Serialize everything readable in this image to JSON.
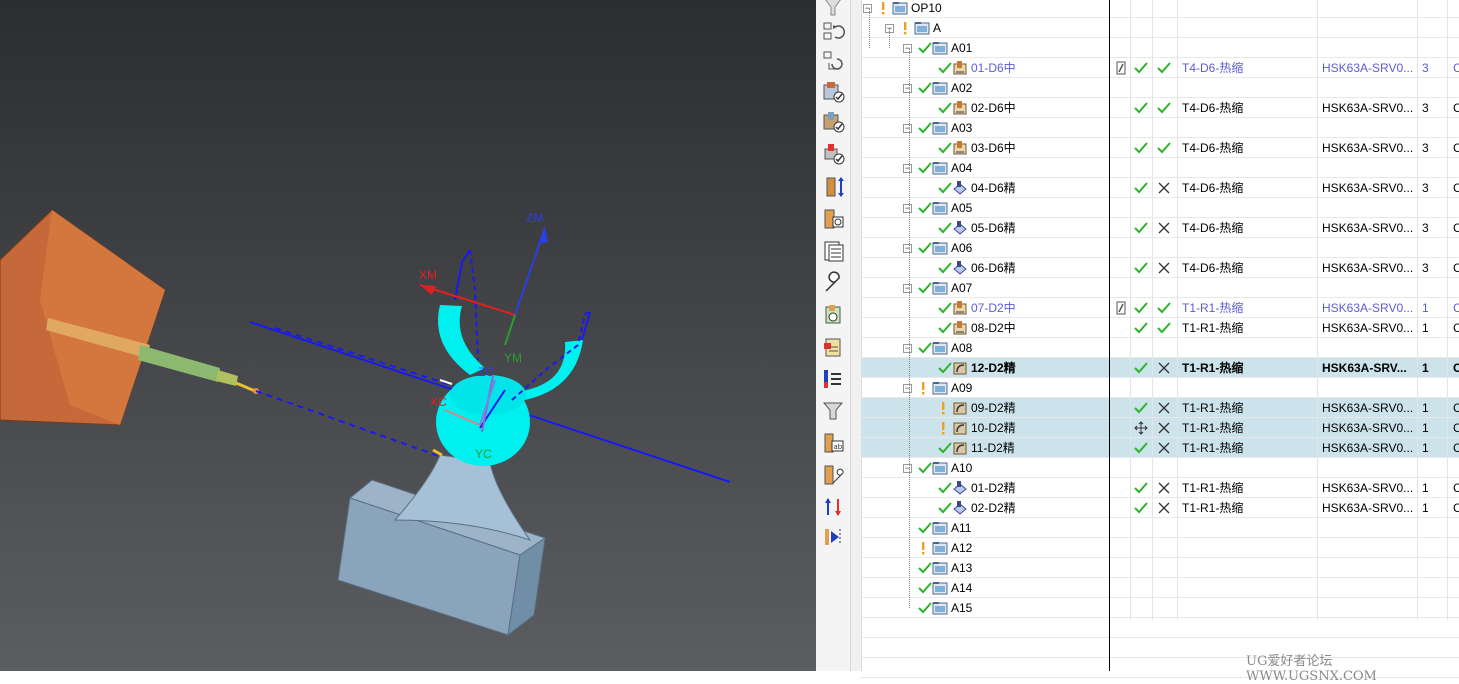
{
  "viewport": {
    "axis_labels": {
      "zm": "ZM",
      "xm": "XM",
      "ym": "YM",
      "zc": "ZC",
      "xc": "XC",
      "yc": "YC"
    }
  },
  "toolbar": {
    "icons": [
      "filter-icon",
      "sync-icon",
      "refresh-icon",
      "verify-icon",
      "check-machine-icon",
      "check-tool-icon",
      "tool-length-icon",
      "tool-holder-icon",
      "shop-docs-icon",
      "wrench-icon",
      "operation-icon",
      "clipboard-icon",
      "align-icon",
      "funnel-icon",
      "tool-list-icon",
      "tool-settings-icon",
      "swap-icon",
      "feed-icon"
    ]
  },
  "navigator": {
    "rows": [
      {
        "level": 0,
        "type": "program",
        "status": "warn",
        "name": "OP10",
        "expand": "minus"
      },
      {
        "level": 1,
        "type": "program",
        "status": "warn",
        "name": "A",
        "expand": "minus"
      },
      {
        "level": 2,
        "type": "program",
        "status": "ok",
        "name": "A01",
        "expand": "minus"
      },
      {
        "level": 3,
        "type": "op-cavity",
        "status": "ok",
        "name": "01-D6中",
        "blue": true,
        "pen": true,
        "gen": "check",
        "ver": "check",
        "tool": "T4-D6-热缩",
        "holder": "HSK63A-SRV0...",
        "num": "3",
        "extra": "C"
      },
      {
        "level": 2,
        "type": "program",
        "status": "ok",
        "name": "A02",
        "expand": "minus"
      },
      {
        "level": 3,
        "type": "op-cavity",
        "status": "ok",
        "name": "02-D6中",
        "gen": "check",
        "ver": "check",
        "tool": "T4-D6-热缩",
        "holder": "HSK63A-SRV0...",
        "num": "3",
        "extra": "C"
      },
      {
        "level": 2,
        "type": "program",
        "status": "ok",
        "name": "A03",
        "expand": "minus"
      },
      {
        "level": 3,
        "type": "op-cavity",
        "status": "ok",
        "name": "03-D6中",
        "gen": "check",
        "ver": "check",
        "tool": "T4-D6-热缩",
        "holder": "HSK63A-SRV0...",
        "num": "3",
        "extra": "C"
      },
      {
        "level": 2,
        "type": "program",
        "status": "ok",
        "name": "A04",
        "expand": "minus"
      },
      {
        "level": 3,
        "type": "op-finish",
        "status": "ok",
        "name": "04-D6精",
        "gen": "check",
        "ver": "cross",
        "tool": "T4-D6-热缩",
        "holder": "HSK63A-SRV0...",
        "num": "3",
        "extra": "C"
      },
      {
        "level": 2,
        "type": "program",
        "status": "ok",
        "name": "A05",
        "expand": "minus"
      },
      {
        "level": 3,
        "type": "op-finish",
        "status": "ok",
        "name": "05-D6精",
        "gen": "check",
        "ver": "cross",
        "tool": "T4-D6-热缩",
        "holder": "HSK63A-SRV0...",
        "num": "3",
        "extra": "C"
      },
      {
        "level": 2,
        "type": "program",
        "status": "ok",
        "name": "A06",
        "expand": "minus"
      },
      {
        "level": 3,
        "type": "op-finish",
        "status": "ok",
        "name": "06-D6精",
        "gen": "check",
        "ver": "cross",
        "tool": "T4-D6-热缩",
        "holder": "HSK63A-SRV0...",
        "num": "3",
        "extra": "C"
      },
      {
        "level": 2,
        "type": "program",
        "status": "ok",
        "name": "A07",
        "expand": "minus"
      },
      {
        "level": 3,
        "type": "op-cavity",
        "status": "ok",
        "name": "07-D2中",
        "blue": true,
        "pen": true,
        "gen": "check",
        "ver": "check",
        "tool": "T1-R1-热缩",
        "holder": "HSK63A-SRV0...",
        "num": "1",
        "extra": "C"
      },
      {
        "level": 3,
        "type": "op-cavity",
        "status": "ok",
        "name": "08-D2中",
        "gen": "check",
        "ver": "check",
        "tool": "T1-R1-热缩",
        "holder": "HSK63A-SRV0...",
        "num": "1",
        "extra": "C"
      },
      {
        "level": 2,
        "type": "program",
        "status": "ok",
        "name": "A08",
        "expand": "minus"
      },
      {
        "level": 3,
        "type": "op-contour",
        "status": "ok",
        "name": "12-D2精",
        "bold": true,
        "hl": true,
        "gen": "check",
        "ver": "cross",
        "tool": "T1-R1-热缩",
        "holder": "HSK63A-SRV...",
        "num": "1",
        "extra": "C"
      },
      {
        "level": 2,
        "type": "program",
        "status": "warn",
        "name": "A09",
        "expand": "minus"
      },
      {
        "level": 3,
        "type": "op-contour",
        "status": "warn",
        "name": "09-D2精",
        "hl": true,
        "gen": "check",
        "ver": "cross",
        "tool": "T1-R1-热缩",
        "holder": "HSK63A-SRV0...",
        "num": "1",
        "extra": "C"
      },
      {
        "level": 3,
        "type": "op-contour",
        "status": "warn",
        "name": "10-D2精",
        "hl": true,
        "gen": "move",
        "ver": "cross",
        "tool": "T1-R1-热缩",
        "holder": "HSK63A-SRV0...",
        "num": "1",
        "extra": "C"
      },
      {
        "level": 3,
        "type": "op-contour",
        "status": "ok",
        "name": "11-D2精",
        "hl": true,
        "gen": "check",
        "ver": "cross",
        "tool": "T1-R1-热缩",
        "holder": "HSK63A-SRV0...",
        "num": "1",
        "extra": "C"
      },
      {
        "level": 2,
        "type": "program",
        "status": "ok",
        "name": "A10",
        "expand": "minus"
      },
      {
        "level": 3,
        "type": "op-finish",
        "status": "ok",
        "name": "01-D2精",
        "gen": "check",
        "ver": "cross",
        "tool": "T1-R1-热缩",
        "holder": "HSK63A-SRV0...",
        "num": "1",
        "extra": "C"
      },
      {
        "level": 3,
        "type": "op-finish",
        "status": "ok",
        "name": "02-D2精",
        "gen": "check",
        "ver": "cross",
        "tool": "T1-R1-热缩",
        "holder": "HSK63A-SRV0...",
        "num": "1",
        "extra": "C"
      },
      {
        "level": 2,
        "type": "program",
        "status": "ok",
        "name": "A11"
      },
      {
        "level": 2,
        "type": "program",
        "status": "warn",
        "name": "A12"
      },
      {
        "level": 2,
        "type": "program",
        "status": "ok",
        "name": "A13"
      },
      {
        "level": 2,
        "type": "program",
        "status": "ok",
        "name": "A14"
      },
      {
        "level": 2,
        "type": "program",
        "status": "ok",
        "name": "A15"
      }
    ]
  },
  "colors": {
    "ok": "#2db52d",
    "warn": "#f0a020",
    "blue_text": "#5c5cd6",
    "highlight": "#cde3eb",
    "part": "#00f0f0",
    "spindle": "#c86a3c",
    "axis_blue": "#1a1af0",
    "axis_red": "#e02020",
    "axis_green": "#2aa02a"
  },
  "watermark": "UG爱好者论坛 WWW.UGSNX.COM"
}
